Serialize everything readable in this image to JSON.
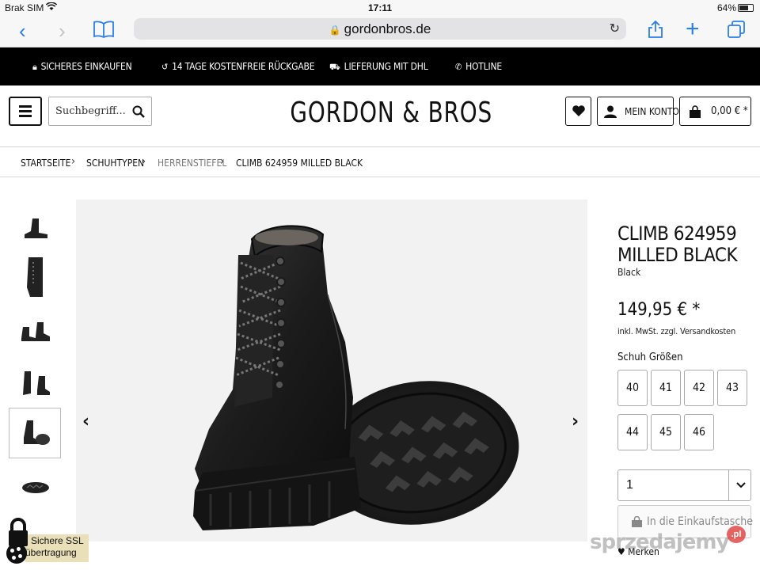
{
  "status_bar": {
    "carrier": "Brak SIM",
    "time": "17:11",
    "battery": "64%"
  },
  "browser": {
    "url": "gordonbros.de"
  },
  "promo": [
    {
      "icon": "lock-icon",
      "text": "Sicheres Einkaufen"
    },
    {
      "icon": "return-icon",
      "text": "14 Tage kostenfreie Rückgabe"
    },
    {
      "icon": "truck-icon",
      "text": "Lieferung mit DHL"
    },
    {
      "icon": "phone-icon",
      "text": "Hotline"
    }
  ],
  "header": {
    "search_placeholder": "Suchbegriff...",
    "logo": "GORDON & BROS",
    "account_label": "MEIN KONTO",
    "cart_label": "0,00 € *"
  },
  "breadcrumb": [
    "Startseite",
    "Schuhtypen",
    "Herrenstiefel",
    "Climb 624959 Milled Black"
  ],
  "product": {
    "title": "CLIMB 624959 MILLED BLACK",
    "color": "Black",
    "price": "149,95 € *",
    "tax_note": "inkl. MwSt. zzgl. Versandkosten",
    "size_label": "Schuh Größen",
    "sizes": [
      "40",
      "41",
      "42",
      "43",
      "44",
      "45",
      "46"
    ],
    "quantity": "1",
    "add_to_cart": "In die Einkaufstasche",
    "wishlist": "Merken"
  },
  "ssl_badge": {
    "line1": "Sichere SSL",
    "line2": "übertragung"
  },
  "watermark": {
    "text": "sprzedajemy",
    "badge": ".pl"
  },
  "colors": {
    "promo_bg": "#000000",
    "image_bg": "#f2f2f2",
    "ios_blue": "#2b7de9",
    "ssl_bg": "#e9dfb8"
  }
}
